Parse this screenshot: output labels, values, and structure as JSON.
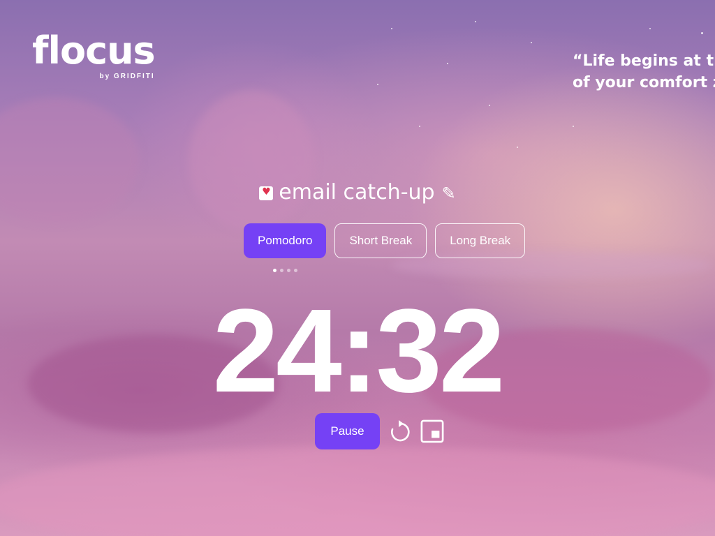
{
  "brand": {
    "name": "flocus",
    "byline": "by GRIDFITI"
  },
  "quote": {
    "line1": "“Life begins at the en",
    "line2": "of your comfort zone"
  },
  "task": {
    "label": "email catch-up"
  },
  "modes": [
    {
      "label": "Pomodoro",
      "active": true
    },
    {
      "label": "Short Break",
      "active": false
    },
    {
      "label": "Long Break",
      "active": false
    }
  ],
  "session_dots": {
    "count": 4,
    "current": 1
  },
  "timer": {
    "display": "24:32"
  },
  "controls": {
    "pause_label": "Pause"
  },
  "colors": {
    "accent": "#7541f5",
    "text": "#ffffff"
  },
  "icons": [
    "heart-card-icon",
    "pencil-icon",
    "reset-icon",
    "picture-in-picture-icon"
  ]
}
